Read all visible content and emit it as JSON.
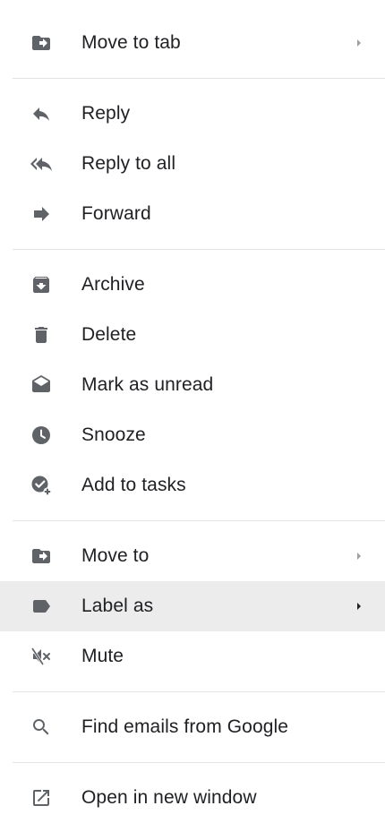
{
  "colors": {
    "icon": "#5f6368",
    "text": "#202124",
    "divider": "#e3e3e3",
    "highlight": "#ececec",
    "chevron_muted": "#9aa0a6",
    "chevron_active": "#202124"
  },
  "menu": {
    "groups": [
      {
        "items": [
          {
            "label": "Move to tab",
            "icon": "move-to-folder-icon",
            "submenu": true
          }
        ]
      },
      {
        "items": [
          {
            "label": "Reply",
            "icon": "reply-icon"
          },
          {
            "label": "Reply to all",
            "icon": "reply-all-icon"
          },
          {
            "label": "Forward",
            "icon": "forward-icon"
          }
        ]
      },
      {
        "items": [
          {
            "label": "Archive",
            "icon": "archive-icon"
          },
          {
            "label": "Delete",
            "icon": "trash-icon"
          },
          {
            "label": "Mark as unread",
            "icon": "mark-unread-icon"
          },
          {
            "label": "Snooze",
            "icon": "clock-icon"
          },
          {
            "label": "Add to tasks",
            "icon": "add-task-icon"
          }
        ]
      },
      {
        "items": [
          {
            "label": "Move to",
            "icon": "move-to-folder-icon",
            "submenu": true
          },
          {
            "label": "Label as",
            "icon": "label-icon",
            "submenu": true,
            "highlighted": true
          },
          {
            "label": "Mute",
            "icon": "mute-icon"
          }
        ]
      },
      {
        "items": [
          {
            "label": "Find emails from Google",
            "icon": "search-icon"
          }
        ]
      },
      {
        "items": [
          {
            "label": "Open in new window",
            "icon": "open-new-window-icon"
          }
        ]
      }
    ]
  }
}
